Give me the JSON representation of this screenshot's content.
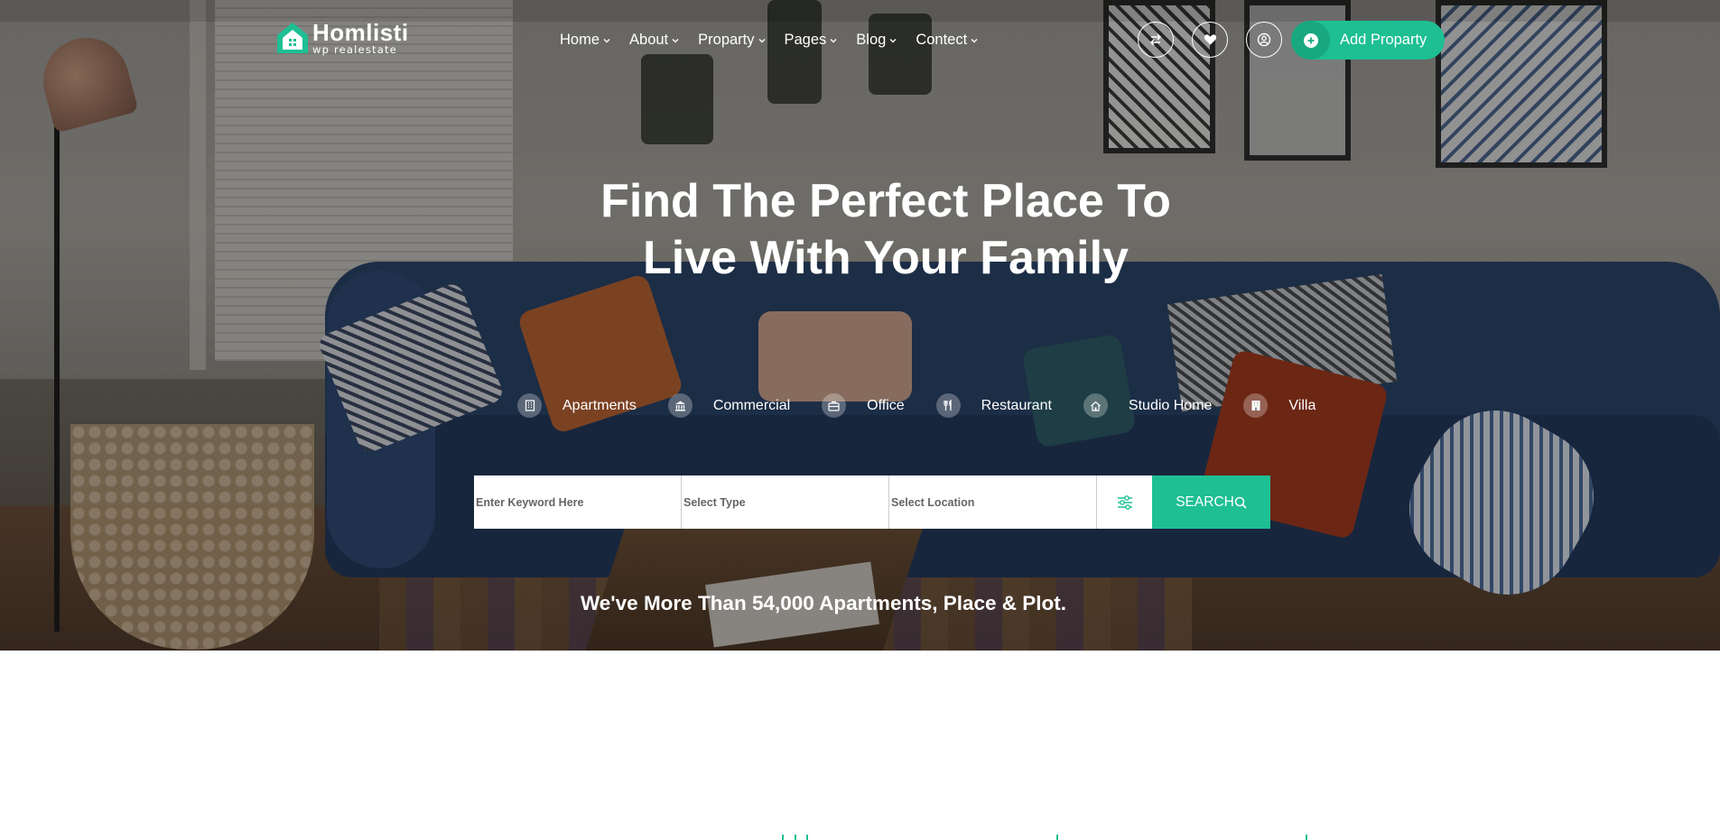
{
  "colors": {
    "accent": "#1dbf93",
    "accent_dark": "#17a880",
    "text_light": "#ffffff"
  },
  "brand": {
    "name": "Homlisti",
    "tagline": "wp realestate"
  },
  "nav": [
    {
      "label": "Home",
      "icon": "chevron-down-icon"
    },
    {
      "label": "About",
      "icon": "chevron-down-icon"
    },
    {
      "label": "Proparty",
      "icon": "chevron-down-icon"
    },
    {
      "label": "Pages",
      "icon": "chevron-down-icon"
    },
    {
      "label": "Blog",
      "icon": "chevron-down-icon"
    },
    {
      "label": "Contect",
      "icon": "chevron-down-icon"
    }
  ],
  "header_icons": [
    "compare-arrows-icon",
    "heart-icon",
    "user-icon"
  ],
  "add_property": {
    "label": "Add Proparty",
    "icon": "plus-circle-icon"
  },
  "hero": {
    "title_line1": "Find The Perfect Place To",
    "title_line2": "Live With Your Family",
    "categories": [
      {
        "label": "Apartments",
        "icon": "building-icon"
      },
      {
        "label": "Commercial",
        "icon": "bank-icon"
      },
      {
        "label": "Office",
        "icon": "briefcase-icon"
      },
      {
        "label": "Restaurant",
        "icon": "fork-knife-icon"
      },
      {
        "label": "Studio Home",
        "icon": "home-icon"
      },
      {
        "label": "Villa",
        "icon": "villa-icon"
      }
    ],
    "search": {
      "keyword_placeholder": "Enter Keyword Here",
      "type_value": "Select Type",
      "location_value": "Select Location",
      "filter_icon": "sliders-icon",
      "button_label": "SEARCH",
      "button_icon": "search-icon"
    },
    "subline": "We've More Than 54,000 Apartments, Place & Plot."
  }
}
